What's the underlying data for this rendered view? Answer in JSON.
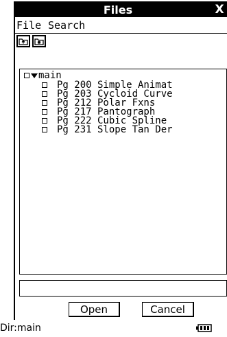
{
  "window": {
    "title": "Files",
    "close_label": "X"
  },
  "menu": {
    "items": [
      "File",
      "Search"
    ]
  },
  "toolbar": {
    "buttons": [
      "folder-up-icon",
      "folder-new-icon"
    ]
  },
  "tree": {
    "root": {
      "label": "main",
      "expanded": true,
      "checked": false
    },
    "files": [
      {
        "name": "Pg 200 Simple Animat",
        "checked": false
      },
      {
        "name": "Pg 203 Cycloid Curve",
        "checked": false
      },
      {
        "name": "Pg 212 Polar Fxns",
        "checked": false
      },
      {
        "name": "Pg 217 Pantograph",
        "checked": false
      },
      {
        "name": "Pg 222 Cubic Spline",
        "checked": false
      },
      {
        "name": "Pg 231 Slope Tan Der",
        "checked": false
      }
    ]
  },
  "path_field": {
    "value": ""
  },
  "buttons": {
    "open": "Open",
    "cancel": "Cancel"
  },
  "status": {
    "text": "Dir:main",
    "battery_icon": "battery-icon"
  }
}
